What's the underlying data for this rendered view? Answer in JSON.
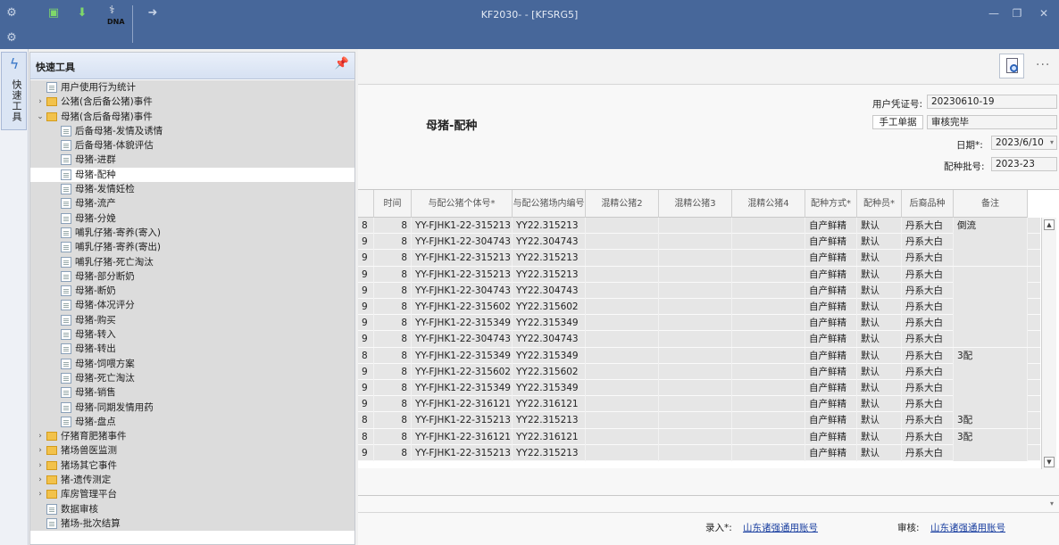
{
  "window": {
    "title": "KF2030- - [KFSRG5]",
    "minimize": "—",
    "restore": "❐",
    "close": "✕",
    "logo_text": "DNA"
  },
  "sidebar_tab": {
    "label": "快速工具"
  },
  "quick_tools": {
    "title": "快速工具",
    "tree": [
      {
        "label": "用户使用行为统计",
        "level": 0,
        "type": "doc"
      },
      {
        "label": "公猪(含后备公猪)事件",
        "level": 0,
        "type": "folder",
        "arrow": "›"
      },
      {
        "label": "母猪(含后备母猪)事件",
        "level": 0,
        "type": "folder",
        "arrow": "⌄"
      },
      {
        "label": "后备母猪-发情及诱情",
        "level": 1,
        "type": "doc"
      },
      {
        "label": "后备母猪-体貌评估",
        "level": 1,
        "type": "doc"
      },
      {
        "label": "母猪-进群",
        "level": 1,
        "type": "doc"
      },
      {
        "label": "母猪-配种",
        "level": 1,
        "type": "doc",
        "selected": true
      },
      {
        "label": "母猪-发情妊检",
        "level": 1,
        "type": "doc"
      },
      {
        "label": "母猪-流产",
        "level": 1,
        "type": "doc"
      },
      {
        "label": "母猪-分娩",
        "level": 1,
        "type": "doc"
      },
      {
        "label": "哺乳仔猪-寄养(寄入)",
        "level": 1,
        "type": "doc"
      },
      {
        "label": "哺乳仔猪-寄养(寄出)",
        "level": 1,
        "type": "doc"
      },
      {
        "label": "哺乳仔猪-死亡淘汰",
        "level": 1,
        "type": "doc"
      },
      {
        "label": "母猪-部分断奶",
        "level": 1,
        "type": "doc"
      },
      {
        "label": "母猪-断奶",
        "level": 1,
        "type": "doc"
      },
      {
        "label": "母猪-体况评分",
        "level": 1,
        "type": "doc"
      },
      {
        "label": "母猪-购买",
        "level": 1,
        "type": "doc"
      },
      {
        "label": "母猪-转入",
        "level": 1,
        "type": "doc"
      },
      {
        "label": "母猪-转出",
        "level": 1,
        "type": "doc"
      },
      {
        "label": "母猪-饲喂方案",
        "level": 1,
        "type": "doc"
      },
      {
        "label": "母猪-死亡淘汰",
        "level": 1,
        "type": "doc"
      },
      {
        "label": "母猪-销售",
        "level": 1,
        "type": "doc"
      },
      {
        "label": "母猪-同期发情用药",
        "level": 1,
        "type": "doc"
      },
      {
        "label": "母猪-盘点",
        "level": 1,
        "type": "doc"
      },
      {
        "label": "仔猪育肥猪事件",
        "level": 0,
        "type": "folder",
        "arrow": "›"
      },
      {
        "label": "猪场兽医监测",
        "level": 0,
        "type": "folder",
        "arrow": "›"
      },
      {
        "label": "猪场其它事件",
        "level": 0,
        "type": "folder",
        "arrow": "›"
      },
      {
        "label": "猪-遗传测定",
        "level": 0,
        "type": "folder",
        "arrow": "›"
      },
      {
        "label": "库房管理平台",
        "level": 0,
        "type": "folder",
        "arrow": "›"
      },
      {
        "label": "数据审核",
        "level": 0,
        "type": "doc"
      },
      {
        "label": "猪场-批次结算",
        "level": 0,
        "type": "doc"
      }
    ]
  },
  "toolbar": {
    "more": "···"
  },
  "form": {
    "doc_title": "母猪-配种",
    "voucher_label": "用户凭证号:",
    "voucher_value": "20230610-19",
    "manual_label": "手工单据",
    "audit_status": "审核完毕",
    "date_label": "日期*:",
    "date_value": "2023/6/10",
    "batch_label": "配种批号:",
    "batch_value": "2023-23"
  },
  "grid": {
    "columns": [
      "",
      "时间",
      "与配公猪个体号*",
      "与配公猪场内编号",
      "混精公猪2",
      "混精公猪3",
      "混精公猪4",
      "配种方式*",
      "配种员*",
      "后裔品种",
      "备注"
    ],
    "rows": [
      [
        "8",
        "8",
        "YY-FJHK1-22-315213",
        "YY22.315213",
        "",
        "",
        "",
        "自产鲜精",
        "默认",
        "丹系大白",
        "倒流"
      ],
      [
        "9",
        "8",
        "YY-FJHK1-22-304743",
        "YY22.304743",
        "",
        "",
        "",
        "自产鲜精",
        "默认",
        "丹系大白",
        ""
      ],
      [
        "9",
        "8",
        "YY-FJHK1-22-315213",
        "YY22.315213",
        "",
        "",
        "",
        "自产鲜精",
        "默认",
        "丹系大白",
        ""
      ],
      [
        "9",
        "8",
        "YY-FJHK1-22-315213",
        "YY22.315213",
        "",
        "",
        "",
        "自产鲜精",
        "默认",
        "丹系大白",
        ""
      ],
      [
        "9",
        "8",
        "YY-FJHK1-22-304743",
        "YY22.304743",
        "",
        "",
        "",
        "自产鲜精",
        "默认",
        "丹系大白",
        ""
      ],
      [
        "9",
        "8",
        "YY-FJHK1-22-315602",
        "YY22.315602",
        "",
        "",
        "",
        "自产鲜精",
        "默认",
        "丹系大白",
        ""
      ],
      [
        "9",
        "8",
        "YY-FJHK1-22-315349",
        "YY22.315349",
        "",
        "",
        "",
        "自产鲜精",
        "默认",
        "丹系大白",
        ""
      ],
      [
        "9",
        "8",
        "YY-FJHK1-22-304743",
        "YY22.304743",
        "",
        "",
        "",
        "自产鲜精",
        "默认",
        "丹系大白",
        ""
      ],
      [
        "8",
        "8",
        "YY-FJHK1-22-315349",
        "YY22.315349",
        "",
        "",
        "",
        "自产鲜精",
        "默认",
        "丹系大白",
        "3配"
      ],
      [
        "9",
        "8",
        "YY-FJHK1-22-315602",
        "YY22.315602",
        "",
        "",
        "",
        "自产鲜精",
        "默认",
        "丹系大白",
        ""
      ],
      [
        "9",
        "8",
        "YY-FJHK1-22-315349",
        "YY22.315349",
        "",
        "",
        "",
        "自产鲜精",
        "默认",
        "丹系大白",
        ""
      ],
      [
        "9",
        "8",
        "YY-FJHK1-22-316121",
        "YY22.316121",
        "",
        "",
        "",
        "自产鲜精",
        "默认",
        "丹系大白",
        ""
      ],
      [
        "8",
        "8",
        "YY-FJHK1-22-315213",
        "YY22.315213",
        "",
        "",
        "",
        "自产鲜精",
        "默认",
        "丹系大白",
        "3配"
      ],
      [
        "8",
        "8",
        "YY-FJHK1-22-316121",
        "YY22.316121",
        "",
        "",
        "",
        "自产鲜精",
        "默认",
        "丹系大白",
        "3配"
      ],
      [
        "9",
        "8",
        "YY-FJHK1-22-315213",
        "YY22.315213",
        "",
        "",
        "",
        "自产鲜精",
        "默认",
        "丹系大白",
        ""
      ]
    ]
  },
  "footer": {
    "entry_label": "录入*:",
    "entry_value": "山东诸强通用账号",
    "audit_label": "审核:",
    "audit_value": "山东诸强通用账号"
  }
}
